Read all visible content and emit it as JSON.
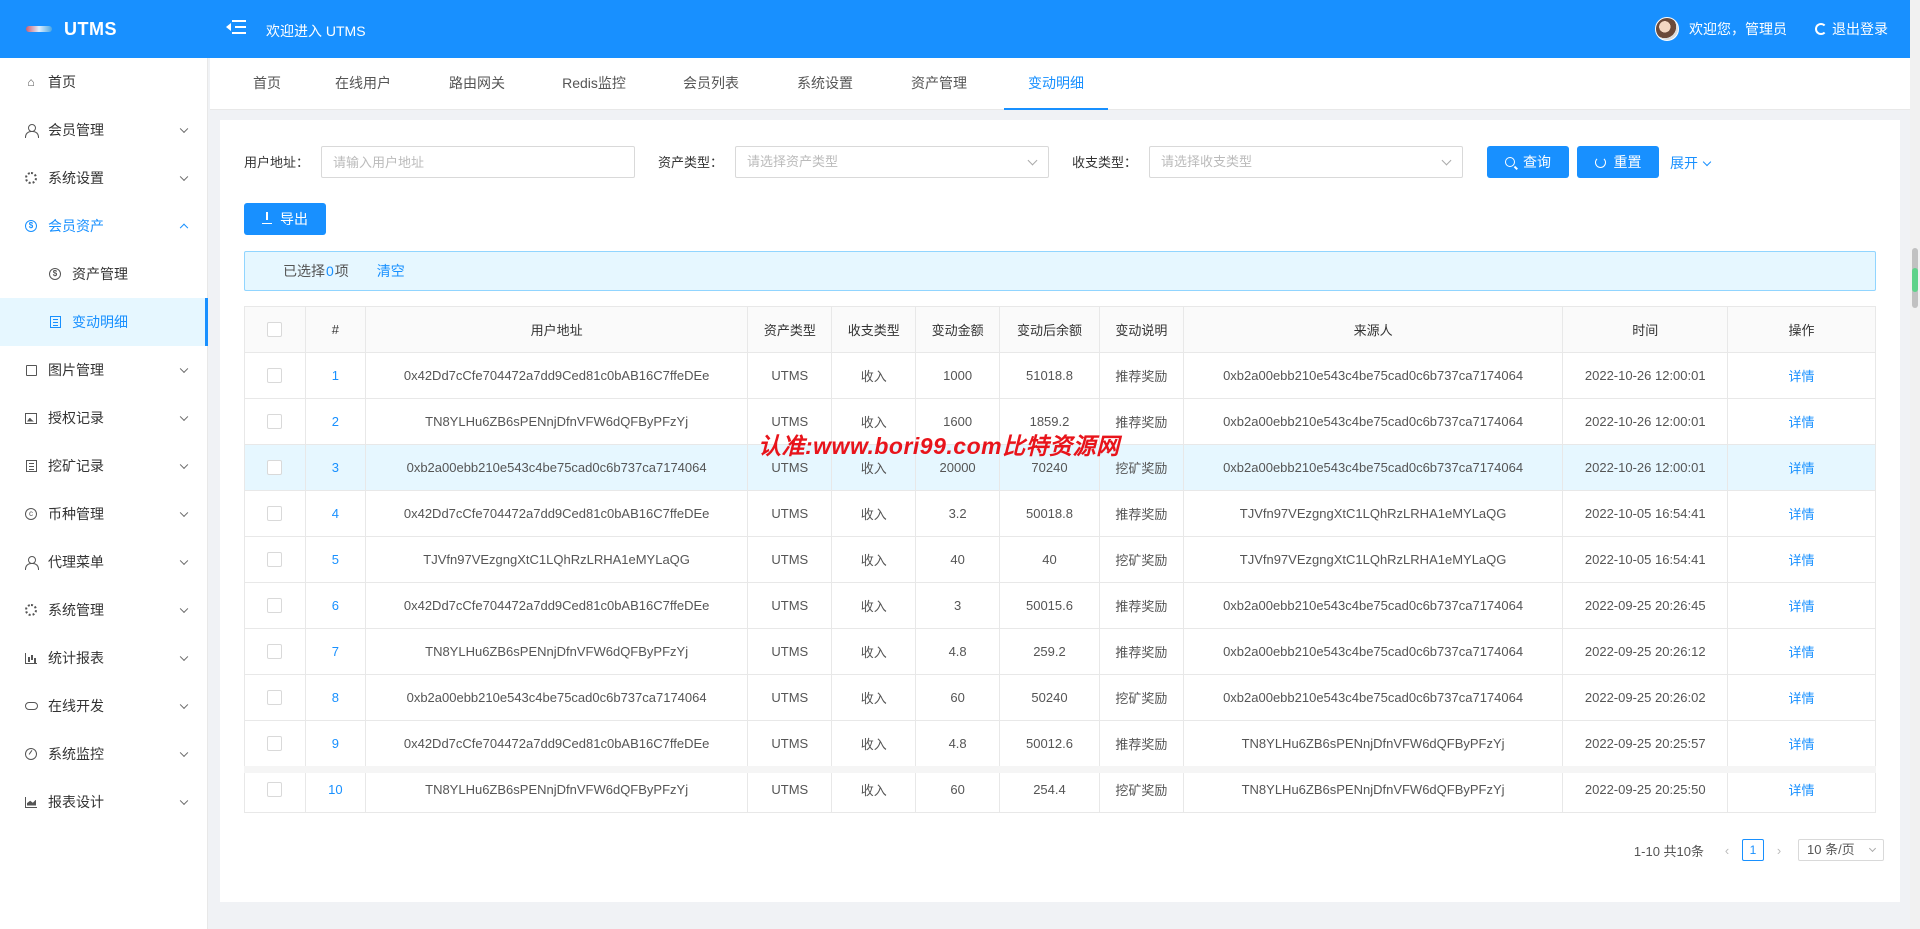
{
  "app": {
    "title": "UTMS",
    "welcome": "欢迎进入 UTMS"
  },
  "header": {
    "greeting": "欢迎您，管理员",
    "logout": "退出登录"
  },
  "sidebar": {
    "items": [
      {
        "label": "首页",
        "icon": "home-icon"
      },
      {
        "label": "会员管理",
        "icon": "user-icon"
      },
      {
        "label": "系统设置",
        "icon": "gear-icon"
      },
      {
        "label": "会员资产",
        "icon": "dollar-icon"
      },
      {
        "label": "资产管理",
        "icon": "dollar-icon"
      },
      {
        "label": "变动明细",
        "icon": "list-icon"
      },
      {
        "label": "图片管理",
        "icon": "square-icon"
      },
      {
        "label": "授权记录",
        "icon": "image-icon"
      },
      {
        "label": "挖矿记录",
        "icon": "list-icon"
      },
      {
        "label": "币种管理",
        "icon": "coin-icon"
      },
      {
        "label": "代理菜单",
        "icon": "user-icon"
      },
      {
        "label": "系统管理",
        "icon": "gear-icon"
      },
      {
        "label": "统计报表",
        "icon": "bar-chart-icon"
      },
      {
        "label": "在线开发",
        "icon": "cloud-icon"
      },
      {
        "label": "系统监控",
        "icon": "gauge-icon"
      },
      {
        "label": "报表设计",
        "icon": "area-chart-icon"
      }
    ]
  },
  "tabs": [
    "首页",
    "在线用户",
    "路由网关",
    "Redis监控",
    "会员列表",
    "系统设置",
    "资产管理",
    "变动明细"
  ],
  "filters": {
    "address_label": "用户地址：",
    "address_placeholder": "请输入用户地址",
    "asset_label": "资产类型：",
    "asset_placeholder": "请选择资产类型",
    "io_label": "收支类型：",
    "io_placeholder": "请选择收支类型",
    "search_btn": "查询",
    "reset_btn": "重置",
    "expand": "展开"
  },
  "toolbar": {
    "export_btn": "导出"
  },
  "selection": {
    "prefix": "已选择 ",
    "count": "0",
    "suffix": "项",
    "clear": "清空"
  },
  "table": {
    "headers": [
      "#",
      "用户地址",
      "资产类型",
      "收支类型",
      "变动金额",
      "变动后余额",
      "变动说明",
      "来源人",
      "时间",
      "操作"
    ],
    "rows": [
      [
        "1",
        "0x42Dd7cCfe704472a7dd9Ced81c0bAB16C7ffeDEe",
        "UTMS",
        "收入",
        "1000",
        "51018.8",
        "推荐奖励",
        "0xb2a00ebb210e543c4be75cad0c6b737ca7174064",
        "2022-10-26 12:00:01",
        "详情"
      ],
      [
        "2",
        "TN8YLHu6ZB6sPENnjDfnVFW6dQFByPFzYj",
        "UTMS",
        "收入",
        "1600",
        "1859.2",
        "推荐奖励",
        "0xb2a00ebb210e543c4be75cad0c6b737ca7174064",
        "2022-10-26 12:00:01",
        "详情"
      ],
      [
        "3",
        "0xb2a00ebb210e543c4be75cad0c6b737ca7174064",
        "UTMS",
        "收入",
        "20000",
        "70240",
        "挖矿奖励",
        "0xb2a00ebb210e543c4be75cad0c6b737ca7174064",
        "2022-10-26 12:00:01",
        "详情"
      ],
      [
        "4",
        "0x42Dd7cCfe704472a7dd9Ced81c0bAB16C7ffeDEe",
        "UTMS",
        "收入",
        "3.2",
        "50018.8",
        "推荐奖励",
        "TJVfn97VEzgngXtC1LQhRzLRHA1eMYLaQG",
        "2022-10-05 16:54:41",
        "详情"
      ],
      [
        "5",
        "TJVfn97VEzgngXtC1LQhRzLRHA1eMYLaQG",
        "UTMS",
        "收入",
        "40",
        "40",
        "挖矿奖励",
        "TJVfn97VEzgngXtC1LQhRzLRHA1eMYLaQG",
        "2022-10-05 16:54:41",
        "详情"
      ],
      [
        "6",
        "0x42Dd7cCfe704472a7dd9Ced81c0bAB16C7ffeDEe",
        "UTMS",
        "收入",
        "3",
        "50015.6",
        "推荐奖励",
        "0xb2a00ebb210e543c4be75cad0c6b737ca7174064",
        "2022-09-25 20:26:45",
        "详情"
      ],
      [
        "7",
        "TN8YLHu6ZB6sPENnjDfnVFW6dQFByPFzYj",
        "UTMS",
        "收入",
        "4.8",
        "259.2",
        "推荐奖励",
        "0xb2a00ebb210e543c4be75cad0c6b737ca7174064",
        "2022-09-25 20:26:12",
        "详情"
      ],
      [
        "8",
        "0xb2a00ebb210e543c4be75cad0c6b737ca7174064",
        "UTMS",
        "收入",
        "60",
        "50240",
        "挖矿奖励",
        "0xb2a00ebb210e543c4be75cad0c6b737ca7174064",
        "2022-09-25 20:26:02",
        "详情"
      ],
      [
        "9",
        "0x42Dd7cCfe704472a7dd9Ced81c0bAB16C7ffeDEe",
        "UTMS",
        "收入",
        "4.8",
        "50012.6",
        "推荐奖励",
        "TN8YLHu6ZB6sPENnjDfnVFW6dQFByPFzYj",
        "2022-09-25 20:25:57",
        "详情"
      ],
      [
        "10",
        "TN8YLHu6ZB6sPENnjDfnVFW6dQFByPFzYj",
        "UTMS",
        "收入",
        "60",
        "254.4",
        "挖矿奖励",
        "TN8YLHu6ZB6sPENnjDfnVFW6dQFByPFzYj",
        "2022-09-25 20:25:50",
        "详情"
      ]
    ]
  },
  "pagination": {
    "total": "1-10 共10条",
    "current": "1",
    "page_size": "10 条/页"
  },
  "watermark": "认准:www.bori99.com比特资源网",
  "colors": {
    "primary": "#1890ff",
    "watermark": "#e8141b"
  }
}
